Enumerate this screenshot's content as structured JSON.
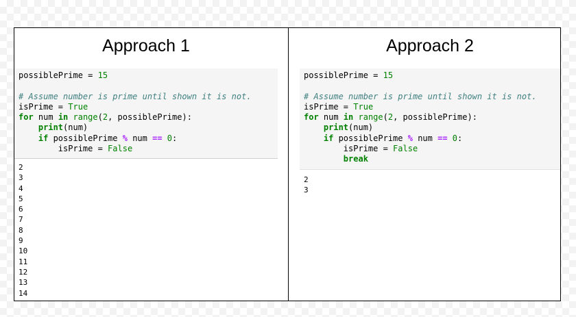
{
  "approach1": {
    "title": "Approach 1",
    "code": {
      "line1_var": "possiblePrime",
      "line1_eq": " = ",
      "line1_num": "15",
      "comment": "# Assume number is prime until shown it is not.",
      "isprime_var": "isPrime",
      "isprime_eq": " = ",
      "true_kw": "True",
      "for_kw": "for",
      "for_mid": " num ",
      "in_kw": "in",
      "range_builtin": "range",
      "range_open": "(",
      "range_num": "2",
      "range_rest": ", possiblePrime):",
      "print_indent": "    ",
      "print_builtin": "print",
      "print_args": "(num)",
      "if_indent": "    ",
      "if_kw": "if",
      "if_mid": " possiblePrime ",
      "mod_op": "%",
      "if_mid2": " num ",
      "eq_op": "==",
      "if_sp": " ",
      "zero": "0",
      "colon": ":",
      "assign_indent": "        ",
      "assign_var": "isPrime = ",
      "false_kw": "False"
    },
    "output": [
      "2",
      "3",
      "4",
      "5",
      "6",
      "7",
      "8",
      "9",
      "10",
      "11",
      "12",
      "13",
      "14"
    ]
  },
  "approach2": {
    "title": "Approach 2",
    "code": {
      "line1_var": "possiblePrime",
      "line1_eq": " = ",
      "line1_num": "15",
      "comment": "# Assume number is prime until shown it is not.",
      "isprime_var": "isPrime",
      "isprime_eq": " = ",
      "true_kw": "True",
      "for_kw": "for",
      "for_mid": " num ",
      "in_kw": "in",
      "range_builtin": "range",
      "range_open": "(",
      "range_num": "2",
      "range_rest": ", possiblePrime):",
      "print_indent": "    ",
      "print_builtin": "print",
      "print_args": "(num)",
      "if_indent": "    ",
      "if_kw": "if",
      "if_mid": " possiblePrime ",
      "mod_op": "%",
      "if_mid2": " num ",
      "eq_op": "==",
      "if_sp": " ",
      "zero": "0",
      "colon": ":",
      "assign_indent": "        ",
      "assign_var": "isPrime = ",
      "false_kw": "False",
      "break_indent": "        ",
      "break_kw": "break"
    },
    "output": [
      "2",
      "3"
    ]
  },
  "colors": {
    "keyword": "#008000",
    "comment": "#408080",
    "operator": "#aa22ff",
    "cell_background": "#f5f5f5"
  }
}
